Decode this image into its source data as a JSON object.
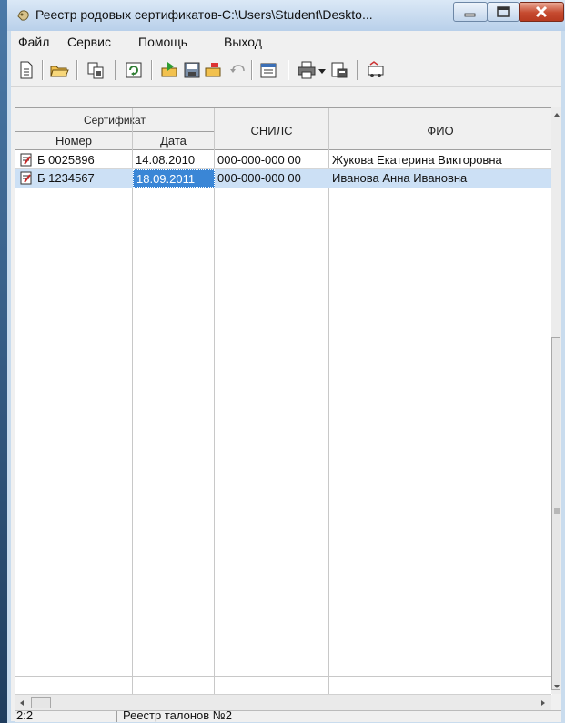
{
  "window": {
    "title": "Реестр родовых сертификатов-C:\\Users\\Student\\Deskto..."
  },
  "menu": [
    "Файл",
    "Сервис",
    "Помощь",
    "Выход"
  ],
  "toolbar_icons": [
    "new-document-icon",
    "open-folder-icon",
    "copy-icon",
    "refresh-icon",
    "import-icon",
    "save-icon",
    "export-icon",
    "undo-icon",
    "properties-icon",
    "print-icon",
    "print-dropdown-icon",
    "print-preview-icon",
    "transfer-icon"
  ],
  "table": {
    "group_header": "Сертификат",
    "columns": {
      "number": "Номер",
      "date": "Дата",
      "snils": "СНИЛС",
      "fio": "ФИО"
    },
    "rows": [
      {
        "number": "Б 0025896",
        "date": "14.08.2010",
        "snils": "000-000-000 00",
        "fio": "Жукова Екатерина Викторовна",
        "selected": false
      },
      {
        "number": "Б 1234567",
        "date": "18.09.2011",
        "snils": "000-000-000 00",
        "fio": "Иванова Анна Ивановна",
        "selected": true
      }
    ]
  },
  "status": {
    "position": "2:2",
    "text": "Реестр талонов №2"
  },
  "colors": {
    "selection": "#cce0f5",
    "active_cell": "#3a86d6"
  }
}
